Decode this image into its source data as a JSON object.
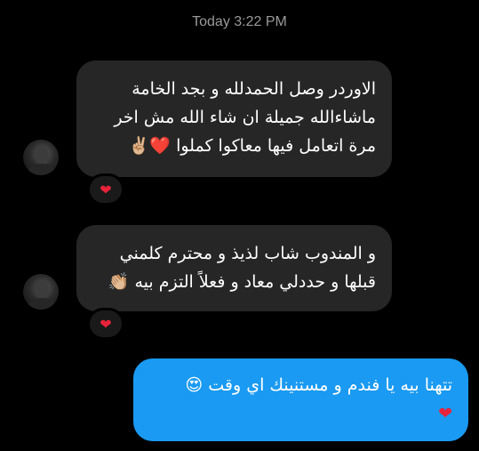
{
  "conversation": {
    "timestamp": "Today 3:22 PM",
    "messages": [
      {
        "direction": "received",
        "lines": [
          "الاوردر وصل الحمدلله و بجد الخامة",
          "ماشاءالله جميلة ان شاء الله مش اخر",
          "مرة اتعامل فيها معاكوا كملوا ❤️✌🏼"
        ],
        "reaction": "❤"
      },
      {
        "direction": "received",
        "lines": [
          "و المندوب شاب لذيذ و محترم كلمني",
          "قبلها و حددلي معاد و فعلاً التزم بيه 👏🏼"
        ],
        "reaction": "❤"
      },
      {
        "direction": "sent",
        "lines": [
          "تتهنا بيه يا فندم و مستنينك اي وقت 😍",
          "❤"
        ]
      }
    ]
  },
  "colors": {
    "background": "#000000",
    "received_bubble": "#262626",
    "sent_bubble": "#1a9af2",
    "timestamp_text": "#9a9a9a",
    "heart": "#e8233b"
  },
  "icons": {
    "avatar": "user-avatar-photo",
    "reaction": "red-heart-icon"
  }
}
